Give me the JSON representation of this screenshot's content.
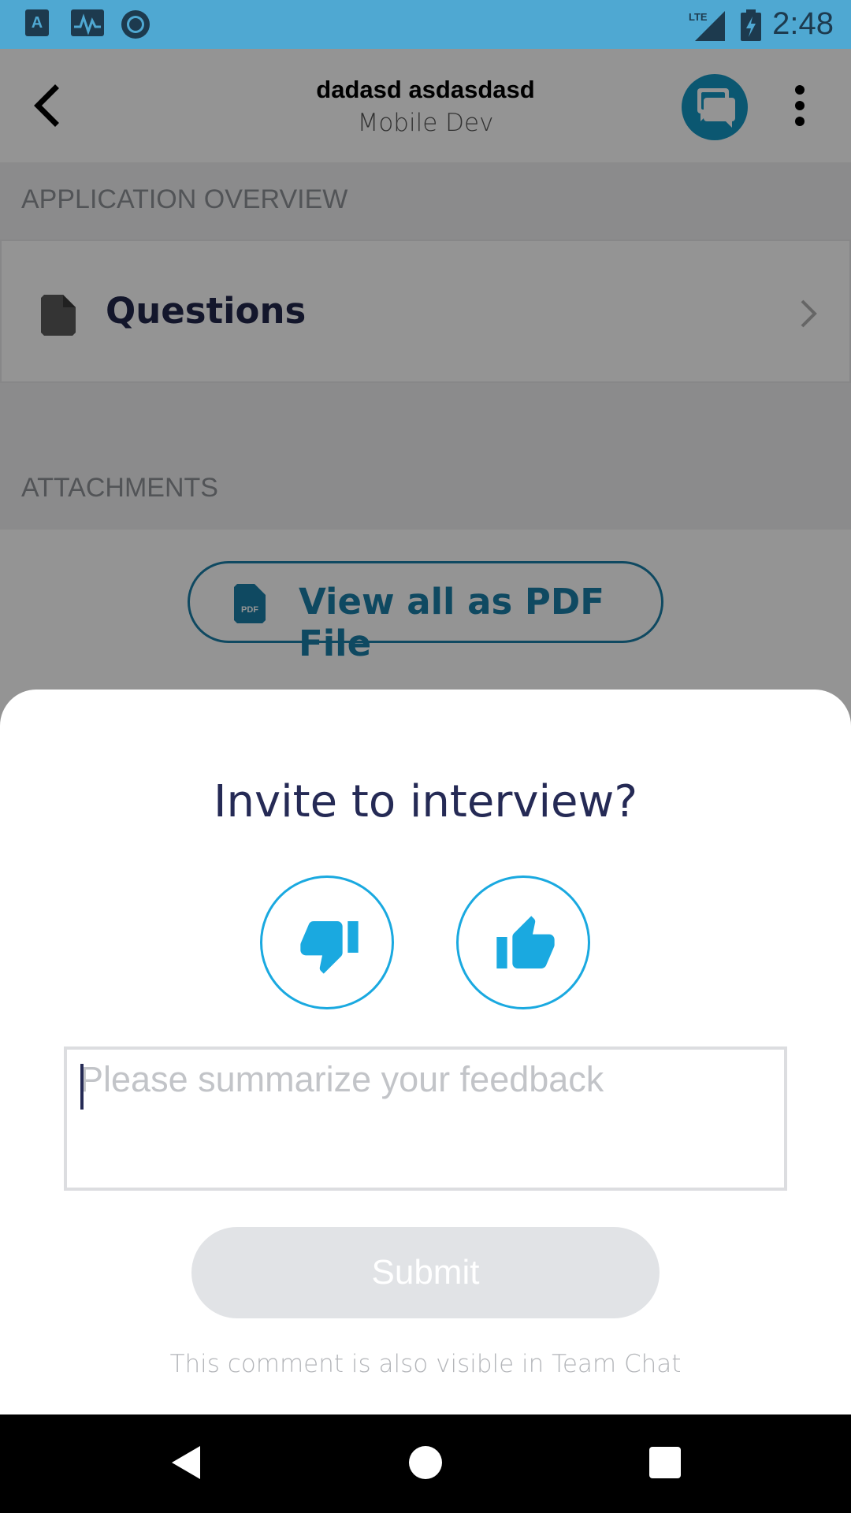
{
  "status_bar": {
    "time": "2:48",
    "icons": [
      "notification-a-icon",
      "activity-monitor-icon",
      "circle-app-icon",
      "lte-signal-icon",
      "battery-charging-icon"
    ]
  },
  "app_bar": {
    "candidate_name": "dadasd asdasdasd",
    "job_title": "Mobile Dev",
    "icons": [
      "back-arrow-icon",
      "team-chat-icon",
      "more-vert-icon"
    ]
  },
  "overview": {
    "section_label": "APPLICATION OVERVIEW",
    "items": [
      {
        "label": "Questions",
        "icon": "document-icon"
      }
    ]
  },
  "attachments": {
    "section_label": "ATTACHMENTS",
    "pdf_button_label": "View all as PDF File"
  },
  "sheet": {
    "title": "Invite to interview?",
    "vote_options": [
      "thumbs-down-icon",
      "thumbs-up-icon"
    ],
    "feedback_placeholder": "Please summarize your feedback",
    "feedback_value": "",
    "submit_label": "Submit",
    "note": "This comment is also visible in Team Chat"
  },
  "colors": {
    "status_bar": "#4fa8d2",
    "accent": "#1aa9e0",
    "primary_dark": "#252a55",
    "link": "#1a7fa8",
    "submit_disabled": "#e1e3e6"
  }
}
